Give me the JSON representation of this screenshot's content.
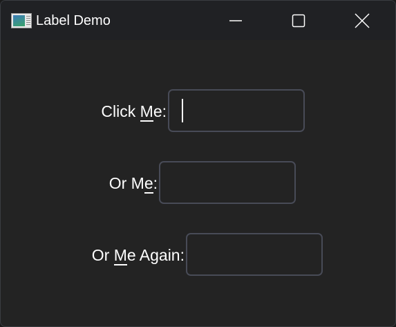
{
  "window": {
    "title": "Label Demo",
    "icon": "app-window-icon"
  },
  "controls": {
    "minimize": "minimize-icon",
    "maximize": "maximize-icon",
    "close": "close-icon"
  },
  "fields": [
    {
      "label_pre": "Click ",
      "label_key": "M",
      "label_post": "e:",
      "value": "",
      "focused": true
    },
    {
      "label_pre": "Or M",
      "label_key": "e",
      "label_post": ":",
      "value": "",
      "focused": false
    },
    {
      "label_pre": "Or ",
      "label_key": "M",
      "label_post": "e Again:",
      "value": "",
      "focused": false
    }
  ]
}
